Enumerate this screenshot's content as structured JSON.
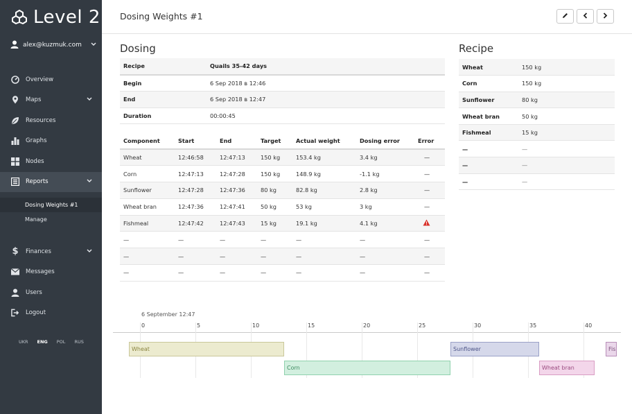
{
  "brand": {
    "name": "Level 2"
  },
  "user": {
    "email": "alex@kuzmuk.com"
  },
  "nav": [
    {
      "label": "Overview",
      "icon": "dashboard-icon"
    },
    {
      "label": "Maps",
      "icon": "map-marker-icon"
    },
    {
      "label": "Resources",
      "icon": "leaf-icon"
    },
    {
      "label": "Graphs",
      "icon": "bar-chart-icon"
    },
    {
      "label": "Nodes",
      "icon": "grid-icon"
    },
    {
      "label": "Reports",
      "icon": "list-icon"
    }
  ],
  "subnav": [
    {
      "label": "Dosing Weights #1"
    },
    {
      "label": "Manage"
    }
  ],
  "nav2": [
    {
      "label": "Finances",
      "icon": "dollar-icon"
    },
    {
      "label": "Messages",
      "icon": "envelope-icon"
    },
    {
      "label": "Users",
      "icon": "user-icon"
    },
    {
      "label": "Logout",
      "icon": "logout-icon"
    }
  ],
  "languages": [
    "UKR",
    "ENG",
    "POL",
    "RUS"
  ],
  "header": {
    "title": "Dosing Weights #1"
  },
  "dosing": {
    "heading": "Dosing",
    "info": [
      {
        "key": "Recipe",
        "value": "Quails 35-42 days"
      },
      {
        "key": "Begin",
        "value": "6 Sep 2018 в 12:46"
      },
      {
        "key": "End",
        "value": "6 Sep 2018 в 12:47"
      },
      {
        "key": "Duration",
        "value": "00:00:45"
      }
    ],
    "columns": [
      "Component",
      "Start",
      "End",
      "Target",
      "Actual weight",
      "Dosing error",
      "Error"
    ],
    "rows": [
      [
        "Wheat",
        "12:46:58",
        "12:47:13",
        "150 kg",
        "153.4 kg",
        "3.4 kg",
        "—"
      ],
      [
        "Corn",
        "12:47:13",
        "12:47:28",
        "150 kg",
        "148.9 kg",
        "-1.1 kg",
        "—"
      ],
      [
        "Sunflower",
        "12:47:28",
        "12:47:36",
        "80 kg",
        "82.8 kg",
        "2.8 kg",
        "—"
      ],
      [
        "Wheat bran",
        "12:47:36",
        "12:47:41",
        "50 kg",
        "53 kg",
        "3 kg",
        "—"
      ],
      [
        "Fishmeal",
        "12:47:42",
        "12:47:43",
        "15 kg",
        "19.1 kg",
        "4.1 kg",
        "warning-icon"
      ],
      [
        "—",
        "—",
        "—",
        "—",
        "—",
        "—",
        "—"
      ],
      [
        "—",
        "—",
        "—",
        "—",
        "—",
        "—",
        "—"
      ],
      [
        "—",
        "—",
        "—",
        "—",
        "—",
        "—",
        "—"
      ]
    ]
  },
  "recipe": {
    "heading": "Recipe",
    "rows": [
      [
        "Wheat",
        "150 kg"
      ],
      [
        "Corn",
        "150 kg"
      ],
      [
        "Sunflower",
        "80 kg"
      ],
      [
        "Wheat bran",
        "50 kg"
      ],
      [
        "Fishmeal",
        "15 kg"
      ],
      [
        "—",
        "—"
      ],
      [
        "—",
        "—"
      ],
      [
        "—",
        "—"
      ]
    ]
  },
  "timeline": {
    "date_label": "6 September 12:47",
    "ticks": [
      "0",
      "5",
      "10",
      "15",
      "20",
      "25",
      "30",
      "35",
      "40"
    ],
    "bars": [
      {
        "label": "Wheat",
        "start": -1,
        "end": 13,
        "row": 0,
        "fill": "#ecebcf",
        "stroke": "#c9c79a",
        "text": "#8a8540"
      },
      {
        "label": "Corn",
        "start": 13,
        "end": 28,
        "row": 1,
        "fill": "#d2efdf",
        "stroke": "#8fd1ad",
        "text": "#3b8a5e"
      },
      {
        "label": "Sunflower",
        "start": 28,
        "end": 36,
        "row": 0,
        "fill": "#d5d8ea",
        "stroke": "#9aa1c7",
        "text": "#4b5387"
      },
      {
        "label": "Wheat bran",
        "start": 36,
        "end": 41,
        "row": 1,
        "fill": "#f3d6ea",
        "stroke": "#d99dc4",
        "text": "#9a4a7f"
      },
      {
        "label": "Fishmeal",
        "start": 42,
        "end": 43,
        "row": 0,
        "fill": "#ead7ea",
        "stroke": "#b88eb8",
        "text": "#7a4f7a"
      }
    ]
  }
}
